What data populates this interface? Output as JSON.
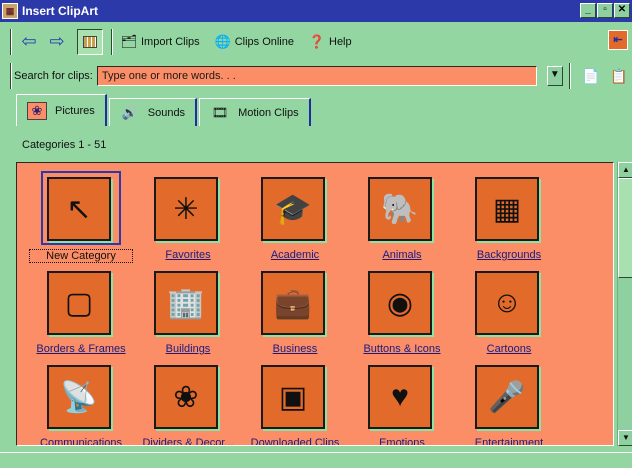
{
  "window": {
    "title": "Insert ClipArt"
  },
  "toolbar": {
    "back_label": "⇦",
    "forward_label": "⇨",
    "import_clips": "Import Clips",
    "clips_online": "Clips Online",
    "help": "Help"
  },
  "search": {
    "label": "Search for clips:",
    "value": "Type one or more words. . ."
  },
  "tabs": [
    {
      "label": "Pictures",
      "icon": "picture-icon"
    },
    {
      "label": "Sounds",
      "icon": "speaker-icon"
    },
    {
      "label": "Motion Clips",
      "icon": "film-icon"
    }
  ],
  "categories_count": "Categories 1 - 51",
  "categories": [
    {
      "label": "New Category",
      "icon": "new-category-icon",
      "glyph": "↖"
    },
    {
      "label": "Favorites",
      "icon": "star-icon",
      "glyph": "✳"
    },
    {
      "label": "Academic",
      "icon": "graduation-cap-icon",
      "glyph": "🎓"
    },
    {
      "label": "Animals",
      "icon": "elephant-icon",
      "glyph": "🐘"
    },
    {
      "label": "Backgrounds",
      "icon": "pattern-icon",
      "glyph": "▦"
    },
    {
      "label": "Borders & Frames",
      "icon": "frame-icon",
      "glyph": "▢"
    },
    {
      "label": "Buildings",
      "icon": "buildings-icon",
      "glyph": "🏢"
    },
    {
      "label": "Business",
      "icon": "briefcase-icon",
      "glyph": "💼"
    },
    {
      "label": "Buttons & Icons",
      "icon": "button-icon",
      "glyph": "◉"
    },
    {
      "label": "Cartoons",
      "icon": "cartoon-icon",
      "glyph": "☺"
    },
    {
      "label": "Communications",
      "icon": "satellite-dish-icon",
      "glyph": "📡"
    },
    {
      "label": "Dividers & Decor...",
      "icon": "divider-icon",
      "glyph": "❀"
    },
    {
      "label": "Downloaded Clips",
      "icon": "clips-collage-icon",
      "glyph": "▣"
    },
    {
      "label": "Emotions",
      "icon": "faces-heart-icon",
      "glyph": "♥"
    },
    {
      "label": "Entertainment",
      "icon": "microphone-icon",
      "glyph": "🎤"
    }
  ]
}
